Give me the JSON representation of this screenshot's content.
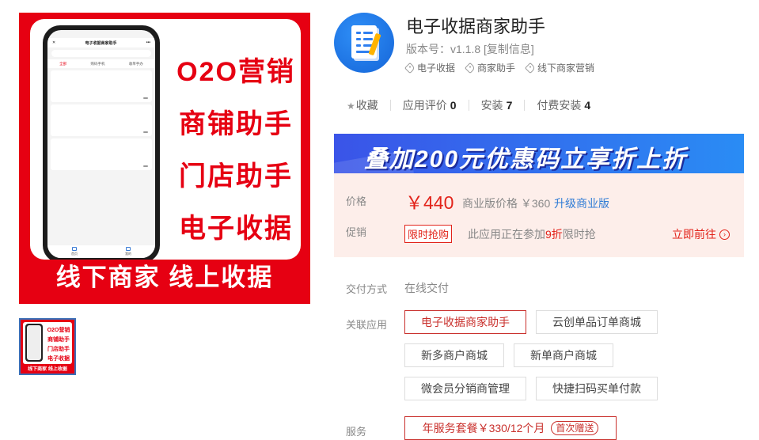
{
  "banner": {
    "slogans": [
      "O2O营销",
      "商铺助手",
      "门店助手",
      "电子收据"
    ],
    "bottom_text": "线下商家 线上收据",
    "phone": {
      "status_left": "",
      "status_right": "",
      "nav_title": "电子收据商家助手",
      "search_placeholder": "",
      "search_action": "",
      "tabs": [
        "全部",
        "购码手机",
        "收单手办"
      ],
      "cards": [
        {
          "line1": "",
          "line2": "",
          "amount": "",
          "button": ""
        },
        {
          "line1": "",
          "line2": "",
          "amount": "",
          "button": ""
        },
        {
          "line1": "",
          "line2": "",
          "amount": "",
          "button": ""
        }
      ],
      "bottom_tabs": [
        "首页",
        "我的"
      ]
    }
  },
  "thumbnail": {
    "slogans": [
      "O2O营销",
      "商铺助手",
      "门店助手",
      "电子收据"
    ],
    "bottom_text": "线下商家 线上收据"
  },
  "app": {
    "name": "电子收据商家助手",
    "version_label": "版本号：v1.1.8",
    "copy_info": "[复制信息]",
    "tags": [
      "电子收据",
      "商家助手",
      "线下商家营销"
    ]
  },
  "stats": {
    "favorite_label": "收藏",
    "rating_label": "应用评价",
    "rating_value": "0",
    "installs_label": "安装",
    "installs_value": "7",
    "paid_installs_label": "付费安装",
    "paid_installs_value": "4"
  },
  "promo_banner": "叠加200元优惠码立享折上折",
  "pricing": {
    "price_label": "价格",
    "price": "￥440",
    "business_price": "商业版价格 ￥360",
    "upgrade_link": "升级商业版",
    "promo_label": "促销",
    "flash_badge": "限时抢购",
    "promo_text_pre": "此应用正在参加",
    "promo_text_discount": "9折",
    "promo_text_post": "限时抢",
    "goto_link": "立即前往"
  },
  "delivery": {
    "label": "交付方式",
    "value": "在线交付"
  },
  "related": {
    "label": "关联应用",
    "apps": [
      "电子收据商家助手",
      "云创单品订单商城",
      "新多商户商城",
      "新单商户商城",
      "微会员分销商管理",
      "快捷扫码买单付款"
    ]
  },
  "service": {
    "label": "服务",
    "package": "年服务套餐￥330/12个月",
    "gift_badge": "首次赠送"
  },
  "colors": {
    "brand_red": "#e60012",
    "price_red": "#e2231a",
    "link_blue": "#2f7bd5",
    "price_bg": "#fdeeea"
  }
}
